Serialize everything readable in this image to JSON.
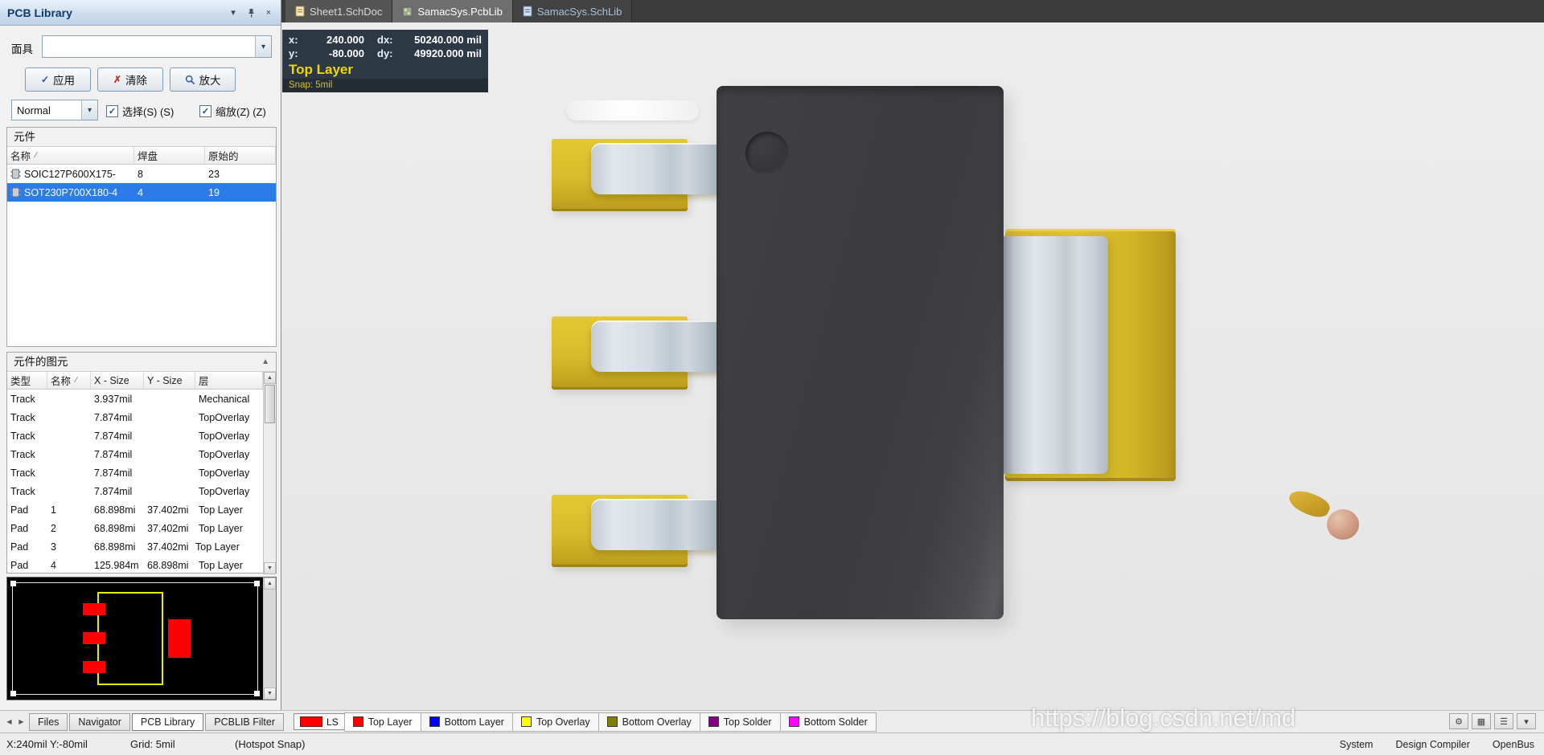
{
  "glyphs": {
    "dropdown": "▾",
    "close": "×",
    "check": "✓",
    "clear": "✗",
    "sort": "∕",
    "caret_left": "◀",
    "caret_right": "▶",
    "caret_up": "▲",
    "caret_down": "▼",
    "gear": "⚙",
    "grid": "▦",
    "menu": "☰"
  },
  "panel": {
    "title": "PCB Library",
    "mask": {
      "label": "面具",
      "value": ""
    },
    "buttons": {
      "apply": "应用",
      "clear": "清除",
      "magnify": "放大"
    },
    "view": {
      "mode": "Normal",
      "select": "选择(S) (S)",
      "zoom": "缩放(Z) (Z)"
    },
    "components": {
      "title": "元件",
      "columns": {
        "name": "名称",
        "pads": "焊盘",
        "primitives": "原始的"
      },
      "rows": [
        {
          "name": "SOIC127P600X175-",
          "pads": "8",
          "primitives": "23"
        },
        {
          "name": "SOT230P700X180-4",
          "pads": "4",
          "primitives": "19"
        }
      ]
    },
    "primitives": {
      "title": "元件的图元",
      "columns": {
        "type": "类型",
        "name": "名称",
        "x": "X - Size",
        "y": "Y - Size",
        "layer": "层"
      },
      "rows": [
        {
          "type": "Track",
          "name": "",
          "x": "3.937mil",
          "y": "",
          "layer": "Mechanical"
        },
        {
          "type": "Track",
          "name": "",
          "x": "7.874mil",
          "y": "",
          "layer": "TopOverlay"
        },
        {
          "type": "Track",
          "name": "",
          "x": "7.874mil",
          "y": "",
          "layer": "TopOverlay"
        },
        {
          "type": "Track",
          "name": "",
          "x": "7.874mil",
          "y": "",
          "layer": "TopOverlay"
        },
        {
          "type": "Track",
          "name": "",
          "x": "7.874mil",
          "y": "",
          "layer": "TopOverlay"
        },
        {
          "type": "Track",
          "name": "",
          "x": "7.874mil",
          "y": "",
          "layer": "TopOverlay"
        },
        {
          "type": "Pad",
          "name": "1",
          "x": "68.898mi",
          "y": "37.402mi",
          "layer": "Top Layer"
        },
        {
          "type": "Pad",
          "name": "2",
          "x": "68.898mi",
          "y": "37.402mi",
          "layer": "Top Layer"
        },
        {
          "type": "Pad",
          "name": "3",
          "x": "68.898mi",
          "y": "37.402mi",
          "layer": "Top Layer"
        },
        {
          "type": "Pad",
          "name": "4",
          "x": "125.984m",
          "y": "68.898mi",
          "layer": "Top Layer"
        }
      ]
    },
    "tabs": [
      {
        "label": "Files"
      },
      {
        "label": "Navigator"
      },
      {
        "label": "PCB Library"
      },
      {
        "label": "PCBLIB Filter"
      }
    ]
  },
  "documents": [
    {
      "label": "Sheet1.SchDoc"
    },
    {
      "label": "SamacSys.PcbLib"
    },
    {
      "label": "SamacSys.SchLib"
    }
  ],
  "hud": {
    "x_label": "x:",
    "x_value": "240.000",
    "dx_label": "dx:",
    "dx_value": "50240.000 mil",
    "y_label": "y:",
    "y_value": "-80.000",
    "dy_label": "dy:",
    "dy_value": "49920.000 mil",
    "layer": "Top Layer",
    "snap": "Snap: 5mil"
  },
  "layer_bar": {
    "ls": "LS",
    "ls_color": "#FF0000",
    "tabs": [
      {
        "label": "Top Layer",
        "color": "#FF0000"
      },
      {
        "label": "Bottom Layer",
        "color": "#0000FF"
      },
      {
        "label": "Top Overlay",
        "color": "#FFFF00"
      },
      {
        "label": "Bottom Overlay",
        "color": "#808000"
      },
      {
        "label": "Top Solder",
        "color": "#800080"
      },
      {
        "label": "Bottom Solder",
        "color": "#FF00FF"
      }
    ]
  },
  "status": {
    "position": "X:240mil Y:-80mil",
    "grid": "Grid: 5mil",
    "snap": "(Hotspot Snap)",
    "panels": [
      "System",
      "Design Compiler",
      "OpenBus"
    ]
  },
  "watermark": {
    "text": "https://blog.csdn.net/md"
  }
}
